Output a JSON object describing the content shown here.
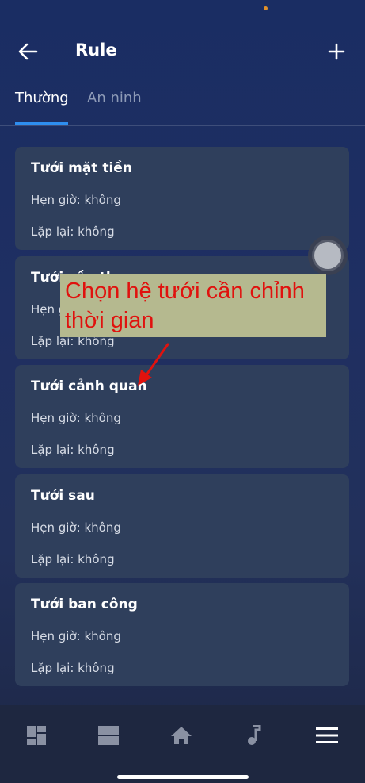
{
  "header": {
    "title": "Rule"
  },
  "tabs": [
    {
      "label": "Thường",
      "active": true
    },
    {
      "label": "An ninh",
      "active": false
    }
  ],
  "rules": [
    {
      "name": "Tưới mặt tiền",
      "timer": "Hẹn giờ: không",
      "repeat": "Lặp lại: không"
    },
    {
      "name": "Tưới cầu thang",
      "timer": "Hẹn giờ: không",
      "repeat": "Lặp lại: không"
    },
    {
      "name": "Tưới cảnh quan",
      "timer": "Hẹn giờ: không",
      "repeat": "Lặp lại: không"
    },
    {
      "name": "Tưới sau",
      "timer": "Hẹn giờ: không",
      "repeat": "Lặp lại: không"
    },
    {
      "name": "Tưới ban công",
      "timer": "Hẹn giờ: không",
      "repeat": "Lặp lại: không"
    }
  ],
  "annotation": {
    "text": "Chọn hệ tưới cần chỉnh thời gian",
    "color": "#e0120e",
    "background": "#b5b98f"
  },
  "bottom_nav": [
    {
      "icon": "dashboard-icon"
    },
    {
      "icon": "view-list-icon"
    },
    {
      "icon": "home-icon"
    },
    {
      "icon": "music-note-icon"
    },
    {
      "icon": "menu-icon",
      "active": true
    }
  ],
  "colors": {
    "accent": "#2e8ef0",
    "card": "#2f3f5c",
    "nav_background": "#1e2740"
  }
}
